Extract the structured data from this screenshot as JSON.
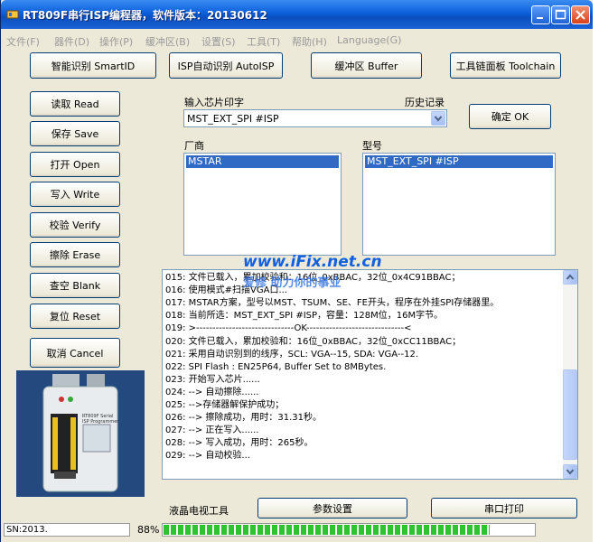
{
  "window": {
    "title": "RT809F串行ISP编程器，软件版本：20130612"
  },
  "menu": [
    "文件(F)",
    "器件(D)",
    "操作(P)",
    "缓冲区(B)",
    "设置(S)",
    "工具(T)",
    "帮助(H)",
    "Language(G)"
  ],
  "top_buttons": {
    "smart_id": "智能识别 SmartID",
    "auto_isp": "ISP自动识别 AutoISP",
    "buffer": "缓冲区 Buffer",
    "toolchain": "工具链面板 Toolchain"
  },
  "side_buttons": {
    "read": "读取 Read",
    "save": "保存 Save",
    "open": "打开 Open",
    "write": "写入 Write",
    "verify": "校验 Verify",
    "erase": "擦除 Erase",
    "blank": "查空 Blank",
    "reset": "复位 Reset",
    "cancel": "取消 Cancel"
  },
  "chip": {
    "label": "输入芯片印字",
    "history_label": "历史记录",
    "value": "MST_EXT_SPI #ISP",
    "confirm": "确定 OK"
  },
  "vendor": {
    "label": "厂商",
    "selected": "MSTAR"
  },
  "model": {
    "label": "型号",
    "selected": "MST_EXT_SPI #ISP"
  },
  "watermark": {
    "line1": "www.iFix.net.cn",
    "line2": "爱修 助力你的事业"
  },
  "log_lines": [
    "015: 文件已载入，累加校验和：16位_0xBBAC，32位_0x4C91BBAC；",
    "016: 使用模式#扫描VGA口...",
    "017: MSTAR方案，型号以MST、TSUM、SE、FE开头，程序在外挂SPI存储器里。",
    "018: 当前所选：MST_EXT_SPI #ISP，容量：128M位，16M字节。",
    "019: >------------------------------OK------------------------------<",
    "020: 文件已载入，累加校验和：16位_0xBBAC，32位_0xCC11BBAC；",
    "021: 采用自动识别到的线序，SCL: VGA--15, SDA: VGA--12.",
    "022: SPI Flash : EN25P64, Buffer Set to 8MBytes.",
    "023: 开始写入芯片......",
    "024: --> 自动擦除......",
    "025: -->存储器解保护成功；",
    "026: --> 擦除成功，用时：31.31秒。",
    "027: --> 正在写入......",
    "028: --> 写入成功，用时：265秒。",
    "029: --> 自动校验..."
  ],
  "bottom": {
    "lcd_tools": "液晶电视工具",
    "param_settings": "参数设置",
    "serial_print": "串口打印"
  },
  "status": {
    "sn": "SN:2013.",
    "progress_text": "88%",
    "progress_fraction": 0.88
  },
  "device_image": {
    "label1": "RT809F Serial",
    "label2": "ISP Programmer"
  },
  "colors": {
    "title_bar": "#0b5fdc",
    "selection": "#316ac5",
    "progress": "#2ec22e",
    "watermark": "#1060e0"
  }
}
